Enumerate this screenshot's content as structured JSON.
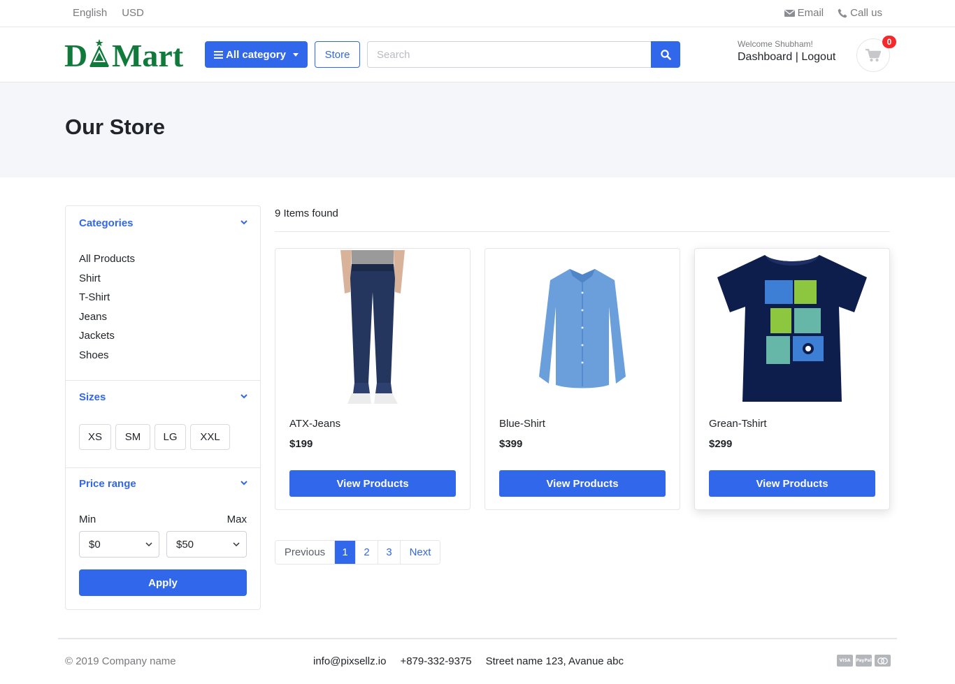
{
  "topbar": {
    "language": "English",
    "currency": "USD",
    "email_label": "Email",
    "call_label": "Call us"
  },
  "header": {
    "logo_text": "DMart",
    "all_category_label": "All category",
    "store_label": "Store",
    "search_placeholder": "Search",
    "welcome": "Welcome Shubham!",
    "dashboard_label": "Dashboard",
    "separator": "|",
    "logout_label": "Logout",
    "cart_count": "0"
  },
  "banner": {
    "title": "Our Store"
  },
  "sidebar": {
    "categories_title": "Categories",
    "categories": [
      "All Products",
      "Shirt",
      "T-Shirt",
      "Jeans",
      "Jackets",
      "Shoes"
    ],
    "sizes_title": "Sizes",
    "sizes": [
      "XS",
      "SM",
      "LG",
      "XXL"
    ],
    "price_title": "Price range",
    "min_label": "Min",
    "max_label": "Max",
    "min_value": "$0",
    "max_value": "$50",
    "apply_label": "Apply"
  },
  "results": {
    "count_text": "9 Items found",
    "products": [
      {
        "name": "ATX-Jeans",
        "price": "$199",
        "button": "View Products"
      },
      {
        "name": "Blue-Shirt",
        "price": "$399",
        "button": "View Products"
      },
      {
        "name": "Grean-Tshirt",
        "price": "$299",
        "button": "View Products"
      }
    ]
  },
  "pagination": {
    "previous": "Previous",
    "pages": [
      "1",
      "2",
      "3"
    ],
    "next": "Next",
    "active": "1"
  },
  "footer": {
    "copyright": "© 2019 Company name",
    "email": "info@pixsellz.io",
    "phone": "+879-332-9375",
    "address": "Street name 123, Avanue abc",
    "payment_icons": [
      "VISA",
      "PayPal",
      "MC"
    ]
  },
  "colors": {
    "primary": "#3167eb",
    "logo_green": "#0f7a3a",
    "badge_red": "#f52929",
    "banner_bg": "#f5f6f9"
  }
}
